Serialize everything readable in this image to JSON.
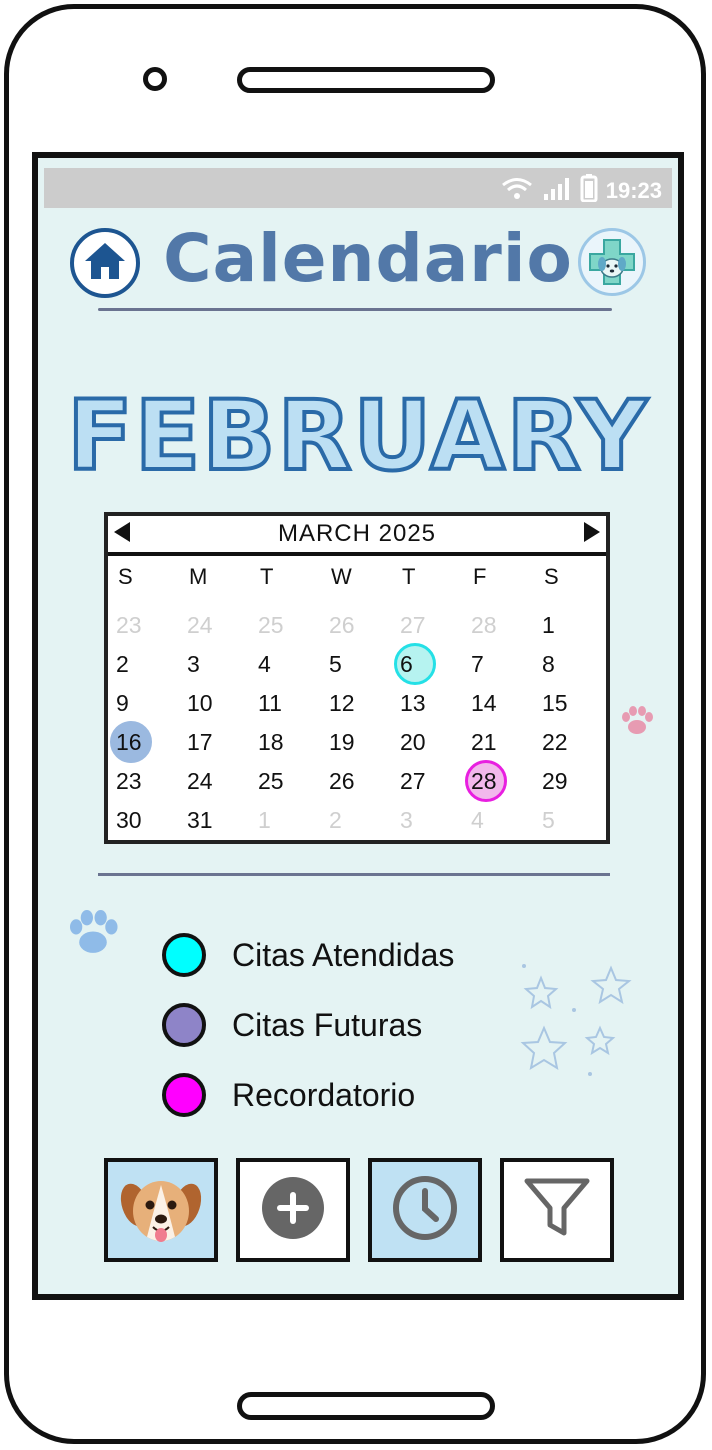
{
  "statusbar": {
    "time": "19:23",
    "wifi_icon": "wifi-icon",
    "signal_icon": "signal-icon",
    "battery_icon": "battery-icon"
  },
  "header": {
    "title": "Calendario",
    "home_icon": "home-icon",
    "logo_icon": "vet-clinic-logo"
  },
  "month_banner": "FEBRUARY",
  "calendar": {
    "title": "MARCH 2025",
    "weekdays": [
      "S",
      "M",
      "T",
      "W",
      "T",
      "F",
      "S"
    ],
    "weeks": [
      [
        {
          "d": "23",
          "muted": true
        },
        {
          "d": "24",
          "muted": true
        },
        {
          "d": "25",
          "muted": true
        },
        {
          "d": "26",
          "muted": true
        },
        {
          "d": "27",
          "muted": true
        },
        {
          "d": "28",
          "muted": true
        },
        {
          "d": "1"
        }
      ],
      [
        {
          "d": "2"
        },
        {
          "d": "3"
        },
        {
          "d": "4"
        },
        {
          "d": "5"
        },
        {
          "d": "6",
          "mark": "attended"
        },
        {
          "d": "7"
        },
        {
          "d": "8"
        }
      ],
      [
        {
          "d": "9"
        },
        {
          "d": "10"
        },
        {
          "d": "11"
        },
        {
          "d": "12"
        },
        {
          "d": "13"
        },
        {
          "d": "14"
        },
        {
          "d": "15"
        }
      ],
      [
        {
          "d": "16",
          "mark": "future"
        },
        {
          "d": "17"
        },
        {
          "d": "18"
        },
        {
          "d": "19"
        },
        {
          "d": "20"
        },
        {
          "d": "21"
        },
        {
          "d": "22"
        }
      ],
      [
        {
          "d": "23"
        },
        {
          "d": "24"
        },
        {
          "d": "25"
        },
        {
          "d": "26"
        },
        {
          "d": "27"
        },
        {
          "d": "28",
          "mark": "reminder"
        },
        {
          "d": "29"
        }
      ],
      [
        {
          "d": "30"
        },
        {
          "d": "31"
        },
        {
          "d": "1",
          "muted": true
        },
        {
          "d": "2",
          "muted": true
        },
        {
          "d": "3",
          "muted": true
        },
        {
          "d": "4",
          "muted": true
        },
        {
          "d": "5",
          "muted": true
        }
      ]
    ]
  },
  "legend": [
    {
      "label": "Citas Atendidas",
      "color": "#00ffff"
    },
    {
      "label": "Citas Futuras",
      "color": "#8e84c8"
    },
    {
      "label": "Recordatorio",
      "color": "#ff00ff"
    }
  ],
  "marks": {
    "attended": {
      "fill": "#b6f3f0",
      "stroke": "#24e0e6"
    },
    "future": {
      "fill": "#9bb9e0",
      "stroke": "#9bb9e0"
    },
    "reminder": {
      "fill": "#f2b8ec",
      "stroke": "#e81fe0"
    }
  },
  "bottom_nav": [
    {
      "name": "pet-profile-tab",
      "icon": "dog-avatar-icon"
    },
    {
      "name": "add-tab",
      "icon": "plus-circle-icon"
    },
    {
      "name": "history-tab",
      "icon": "clock-icon",
      "active": true
    },
    {
      "name": "filter-tab",
      "icon": "filter-icon"
    }
  ],
  "colors": {
    "screen_bg": "#e4f3f3",
    "title": "#5278a8",
    "accent": "#2a6aa8"
  }
}
